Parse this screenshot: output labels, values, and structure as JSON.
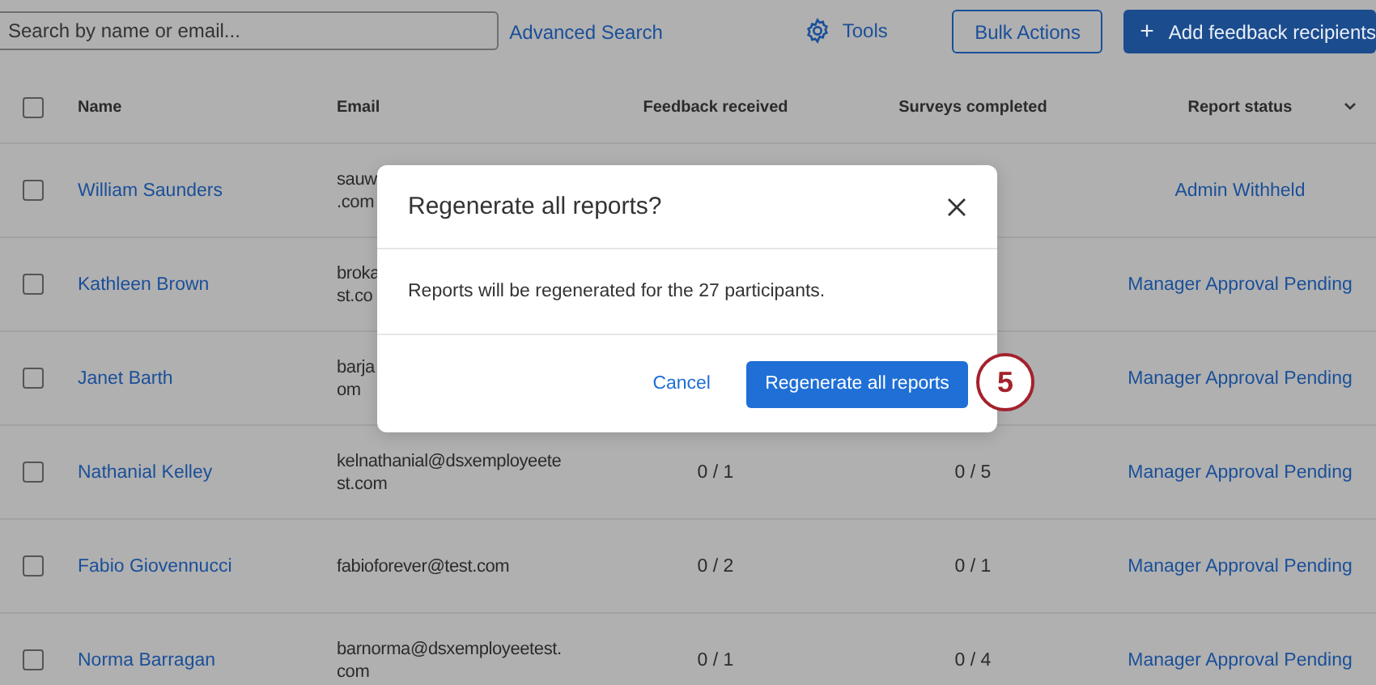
{
  "toolbar": {
    "search": {
      "placeholder": "Search by name or email..."
    },
    "advanced_search": "Advanced Search",
    "tools": "Tools",
    "bulk_actions": "Bulk Actions",
    "add_button": {
      "icon": "+",
      "label": "Add feedback recipients"
    }
  },
  "table": {
    "select_all": {
      "checked": false
    },
    "columns": [
      "Name",
      "Email",
      "Feedback received",
      "Surveys completed",
      "Report status"
    ],
    "rows": [
      {
        "checked": false,
        "name": "William Saunders",
        "email_lines": [
          "sauw",
          ".com"
        ],
        "status": "Admin Withheld"
      },
      {
        "checked": false,
        "name": "Kathleen Brown",
        "email_lines": [
          "broka",
          "st.co"
        ],
        "status": "Manager Approval Pending"
      },
      {
        "checked": false,
        "name": "Janet Barth",
        "email_lines": [
          "barja",
          "om"
        ],
        "status": "Manager Approval Pending"
      },
      {
        "checked": false,
        "name": "Nathanial Kelley",
        "email_lines": [
          "kelnathanial@dsxemployeete",
          "st.com"
        ],
        "feedback": "0 / 1",
        "surveys": "0 / 5",
        "status": "Manager Approval Pending"
      },
      {
        "checked": false,
        "name": "Fabio Giovennucci",
        "email_lines": [
          "fabioforever@test.com"
        ],
        "feedback": "0 / 2",
        "surveys": "0 / 1",
        "status": "Manager Approval Pending"
      },
      {
        "checked": false,
        "name": "Norma Barragan",
        "email_lines": [
          "barnorma@dsxemployeetest.",
          "com"
        ],
        "feedback": "0 / 1",
        "surveys": "0 / 4",
        "status": "Manager Approval Pending"
      }
    ]
  },
  "dialog": {
    "title": "Regenerate all reports?",
    "message": "Reports will be regenerated for the 27 participants.",
    "cancel": "Cancel",
    "confirm": "Regenerate all reports"
  },
  "step_badge": "5"
}
